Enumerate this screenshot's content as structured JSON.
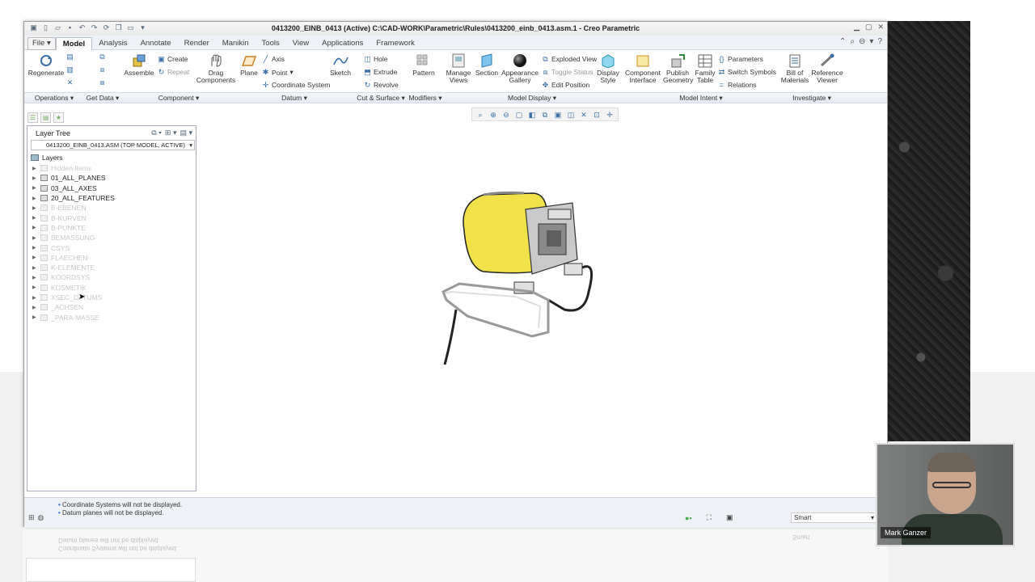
{
  "window": {
    "title": "0413200_EINB_0413 (Active) C:\\CAD-WORK\\Parametric\\Rules\\0413200_einb_0413.asm.1 - Creo Parametric"
  },
  "menus": [
    "File",
    "Model",
    "Analysis",
    "Annotate",
    "Render",
    "Manikin",
    "Tools",
    "View",
    "Applications",
    "Framework"
  ],
  "ribbon": {
    "regenerate": "Regenerate",
    "assemble": "Assemble",
    "create": "Create",
    "repeat": "Repeat",
    "drag_components": "Drag Components",
    "plane": "Plane",
    "axis": "Axis",
    "point": "Point",
    "coordinate_system": "Coordinate System",
    "sketch": "Sketch",
    "hole": "Hole",
    "extrude": "Extrude",
    "revolve": "Revolve",
    "pattern": "Pattern",
    "manage_views": "Manage Views",
    "section": "Section",
    "appearance_gallery": "Appearance Gallery",
    "exploded_view": "Exploded View",
    "toggle_status": "Toggle Status",
    "edit_position": "Edit Position",
    "display_style": "Display Style",
    "component_interface": "Component Interface",
    "publish_geometry": "Publish Geometry",
    "family_table": "Family Table",
    "parameters": "Parameters",
    "switch_symbols": "Switch Symbols",
    "relations": "Relations",
    "bill_of_materials": "Bill of Materials",
    "reference_viewer": "Reference Viewer"
  },
  "groups": [
    "Operations",
    "Get Data",
    "Component",
    "Datum",
    "Cut & Surface",
    "Modifiers",
    "Model Display",
    "Model Intent",
    "Investigate"
  ],
  "layer_tree": {
    "title": "Layer Tree",
    "model": "0413200_EINB_0413.ASM (TOP MODEL, ACTIVE)",
    "root": "Layers",
    "layers": [
      {
        "name": "Hidden Items",
        "hidden": true
      },
      {
        "name": "01_ALL_PLANES",
        "hidden": false
      },
      {
        "name": "03_ALL_AXES",
        "hidden": false
      },
      {
        "name": "20_ALL_FEATURES",
        "hidden": false
      },
      {
        "name": "B-EBENEN",
        "hidden": true
      },
      {
        "name": "B-KURVEN",
        "hidden": true
      },
      {
        "name": "B-PUNKTE",
        "hidden": true
      },
      {
        "name": "BEMASSUNG",
        "hidden": true
      },
      {
        "name": "CSYS",
        "hidden": true
      },
      {
        "name": "FLAECHEN",
        "hidden": true
      },
      {
        "name": "K-ELEMENTE",
        "hidden": true
      },
      {
        "name": "KOORDSYS",
        "hidden": true
      },
      {
        "name": "KOSMETIK",
        "hidden": true
      },
      {
        "name": "XSEC_DATUMS",
        "hidden": true
      },
      {
        "name": "_ACHSEN",
        "hidden": true
      },
      {
        "name": "_PARA-MASSE",
        "hidden": true
      }
    ]
  },
  "status": {
    "messages": [
      "Coordinate Systems will not be displayed.",
      "Datum planes will not be displayed."
    ],
    "filter": "Smart"
  },
  "webcam": {
    "name": "Mark Ganzer"
  },
  "colors": {
    "accent": "#3a6ea5",
    "model_yellow": "#f2e24a",
    "menubar": "#eef1f5"
  }
}
